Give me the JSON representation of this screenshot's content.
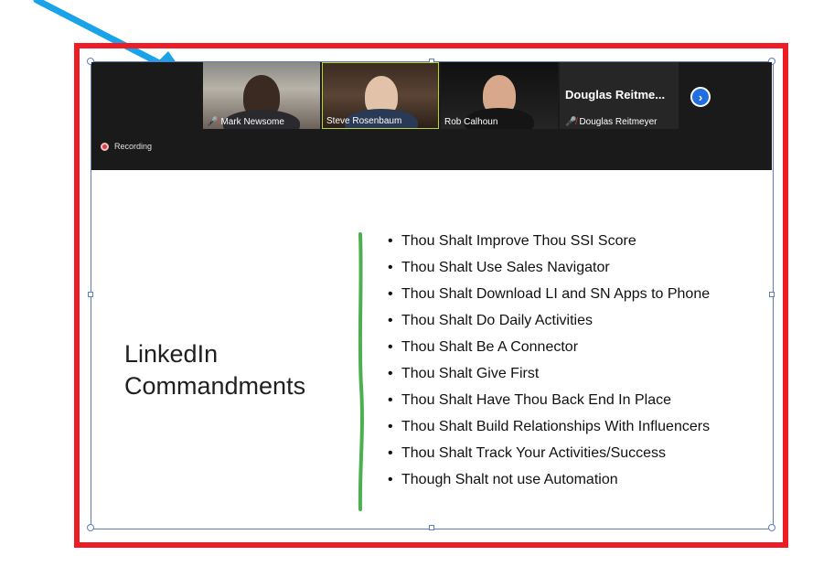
{
  "participants": [
    {
      "name": "Mark Newsome",
      "muted": true
    },
    {
      "name": "Steve Rosenbaum",
      "muted": false,
      "active_speaker": true
    },
    {
      "name": "Rob Calhoun",
      "muted": false
    },
    {
      "name": "Douglas Reitmeyer",
      "display_name": "Douglas  Reitme...",
      "muted": true,
      "video": false
    }
  ],
  "status": {
    "recording_label": "Recording"
  },
  "slide": {
    "title_line1": "LinkedIn",
    "title_line2": "Commandments",
    "bullets": [
      "Thou Shalt Improve Thou SSI Score",
      "Thou Shalt Use Sales Navigator",
      "Thou Shalt Download LI and SN Apps to Phone",
      "Thou Shalt Do Daily Activities",
      "Thou Shalt Be A Connector",
      "Thou Shalt Give First",
      "Thou Shalt Have Thou Back End In Place",
      "Thou Shalt Build Relationships With Influencers",
      "Thou Shalt Track Your Activities/Success",
      "Though Shalt not use Automation"
    ]
  },
  "icons": {
    "mic_off": "microphone-muted-icon",
    "next": "chevron-right-icon",
    "recording": "recording-dot-icon",
    "annotation": "arrow-icon"
  },
  "colors": {
    "frame_red": "#ee1c24",
    "arrow_blue": "#1aa3e8",
    "accent_green": "#4caf50",
    "next_button_blue": "#1f6fe0",
    "active_speaker_border": "#b8d43a"
  }
}
